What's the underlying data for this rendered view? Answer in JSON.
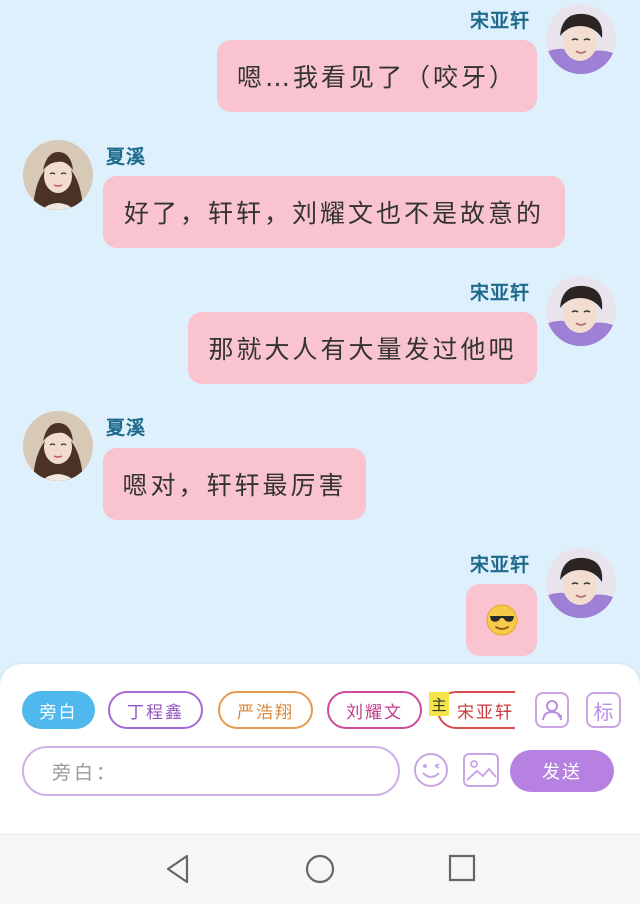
{
  "messages": [
    {
      "sender": "宋亚轩",
      "side": "right",
      "text": "嗯…我看见了（咬牙）"
    },
    {
      "sender": "夏溪",
      "side": "left",
      "text": "好了，轩轩，刘耀文也不是故意的"
    },
    {
      "sender": "宋亚轩",
      "side": "right",
      "text": "那就大人有大量发过他吧"
    },
    {
      "sender": "夏溪",
      "side": "left",
      "text": "嗯对，轩轩最厉害"
    },
    {
      "sender": "宋亚轩",
      "side": "right",
      "text": "",
      "emoji": "sunglasses-face"
    }
  ],
  "roles": [
    {
      "label": "旁白",
      "color": "#4fb8ec",
      "selected": true
    },
    {
      "label": "丁程鑫",
      "color": "#a66bd6",
      "selected": false
    },
    {
      "label": "严浩翔",
      "color": "#e59a4f",
      "selected": false
    },
    {
      "label": "刘耀文",
      "color": "#cf4a9a",
      "selected": false
    },
    {
      "label": "宋亚轩",
      "color": "#d94d4d",
      "selected": false,
      "badge": "主"
    }
  ],
  "toolbar": {
    "contact_icon": "contact-card-icon",
    "tag_label": "标",
    "emoji_icon": "smiley-icon",
    "image_icon": "image-icon"
  },
  "composer": {
    "placeholder": "旁白：",
    "send_label": "发送"
  },
  "navbar": {
    "back_icon": "triangle-back-icon",
    "home_icon": "circle-home-icon",
    "recent_icon": "square-recent-icon"
  }
}
